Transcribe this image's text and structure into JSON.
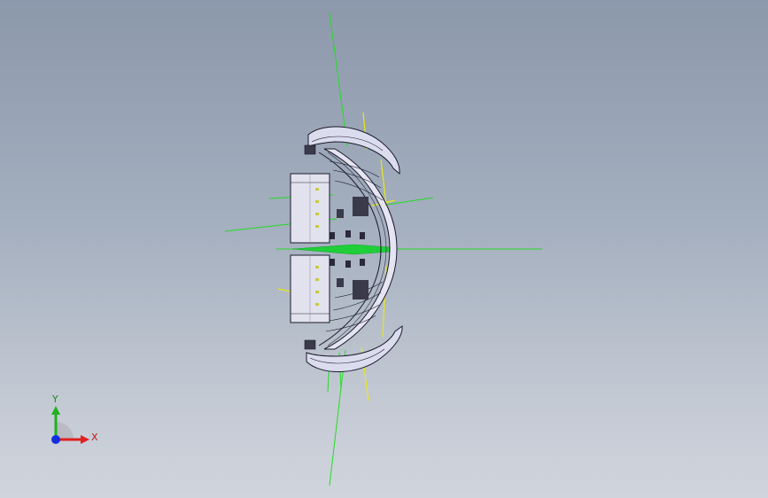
{
  "viewport": {
    "background_top": "#8c98ab",
    "background_bottom": "#d0d5dd",
    "model_color": "#dcdcef",
    "construction_line_color": "#22dd22",
    "sketch_line_color": "#e8e81a"
  },
  "triad": {
    "x_label": "X",
    "y_label": "Y",
    "x_color": "#e02020",
    "y_color": "#20b020",
    "z_color": "#1030e0"
  }
}
